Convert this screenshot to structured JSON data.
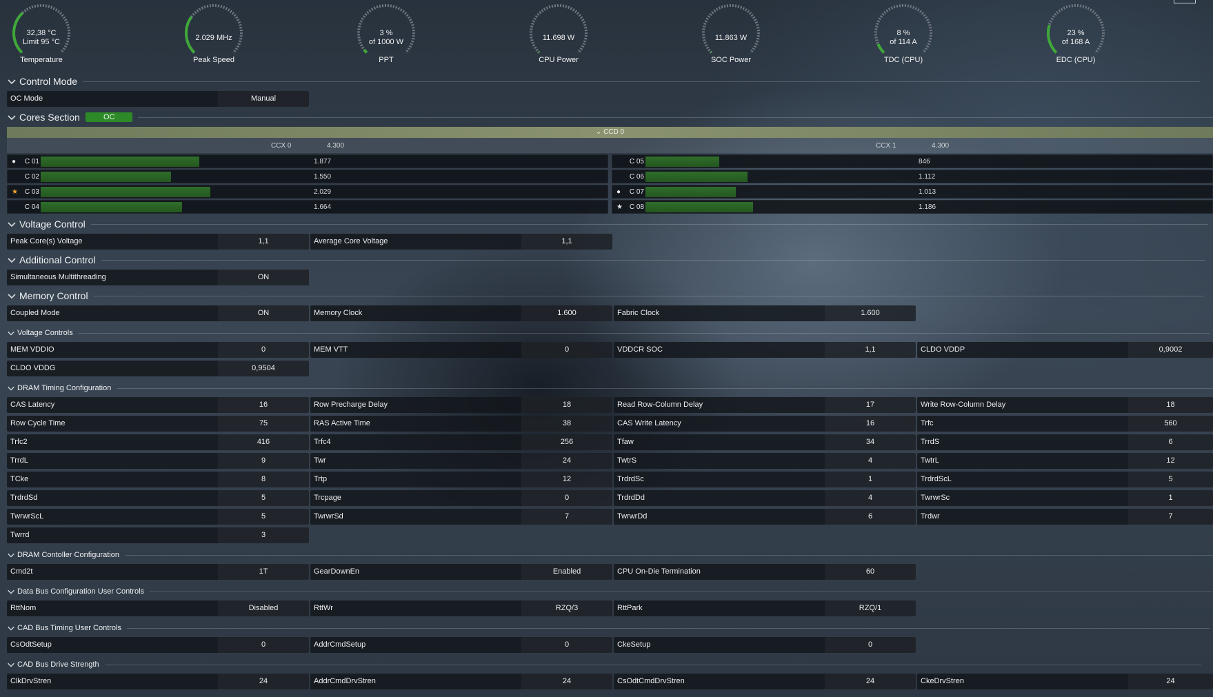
{
  "colors": {
    "accent": "#2e8a28",
    "gauge_track": "#6f7780",
    "gauge_fill": "#3fa838"
  },
  "gauges": [
    {
      "line1": "32,38 °C",
      "line2": "Limit 95 °C",
      "title": "Temperature",
      "level": 0.34
    },
    {
      "line1": "2.029  MHz",
      "line2": "",
      "title": "Peak Speed",
      "level": 0.3
    },
    {
      "line1": "3 %",
      "line2": "of 1000 W",
      "title": "PPT",
      "level": 0.03
    },
    {
      "line1": "11.698 W",
      "line2": "",
      "title": "CPU Power",
      "level": 0.0
    },
    {
      "line1": "11.863 W",
      "line2": "",
      "title": "SOC Power",
      "level": 0.0
    },
    {
      "line1": "8 %",
      "line2": "of 114 A",
      "title": "TDC (CPU)",
      "level": 0.08
    },
    {
      "line1": "23 %",
      "line2": "of 168 A",
      "title": "EDC (CPU)",
      "level": 0.23
    }
  ],
  "sections": {
    "control_mode": "Control Mode",
    "cores_section": "Cores Section",
    "cores_badge": "OC",
    "voltage_control": "Voltage Control",
    "additional_control": "Additional Control",
    "memory_control": "Memory Control",
    "voltage_controls": "Voltage Controls",
    "dram_timing": "DRAM Timing Configuration",
    "dram_controller": "DRAM Contoller Configuration",
    "data_bus": "Data Bus Configuration User Controls",
    "cad_timing": "CAD Bus Timing User Controls",
    "cad_drive": "CAD Bus Drive Strength"
  },
  "control_mode": [
    {
      "k": "OC Mode",
      "v": "Manual"
    }
  ],
  "ccd": {
    "label": "CCD 0",
    "ccx0": {
      "label": "CCX 0",
      "freq": "4.300"
    },
    "ccx1": {
      "label": "CCX 1",
      "freq": "4.300"
    },
    "cores_left": [
      {
        "name": "C 01",
        "value": "1.877",
        "mark": "dot",
        "fill": 0.28
      },
      {
        "name": "C 02",
        "value": "1.550",
        "mark": "",
        "fill": 0.23
      },
      {
        "name": "C 03",
        "value": "2.029",
        "mark": "star",
        "fill": 0.3
      },
      {
        "name": "C 04",
        "value": "1.664",
        "mark": "",
        "fill": 0.25
      }
    ],
    "cores_right": [
      {
        "name": "C 05",
        "value": "846",
        "mark": "",
        "fill": 0.13
      },
      {
        "name": "C 06",
        "value": "1.112",
        "mark": "",
        "fill": 0.18
      },
      {
        "name": "C 07",
        "value": "1.013",
        "mark": "dot",
        "fill": 0.16
      },
      {
        "name": "C 08",
        "value": "1.186",
        "mark": "star-white",
        "fill": 0.19
      }
    ]
  },
  "voltage_control": [
    {
      "k": "Peak Core(s) Voltage",
      "v": "1,1"
    },
    {
      "k": "Average Core Voltage",
      "v": "1,1"
    }
  ],
  "additional_control": [
    {
      "k": "Simultaneous Multithreading",
      "v": "ON"
    }
  ],
  "memory_control": [
    {
      "k": "Coupled Mode",
      "v": "ON"
    },
    {
      "k": "Memory Clock",
      "v": "1.600"
    },
    {
      "k": "Fabric Clock",
      "v": "1.600"
    }
  ],
  "voltage_controls": [
    {
      "k": "MEM VDDIO",
      "v": "0"
    },
    {
      "k": "MEM VTT",
      "v": "0"
    },
    {
      "k": "VDDCR SOC",
      "v": "1,1"
    },
    {
      "k": "CLDO VDDP",
      "v": "0,9002"
    },
    {
      "k": "CLDO VDDG",
      "v": "0,9504"
    }
  ],
  "dram_timing": [
    {
      "k": "CAS Latency",
      "v": "16"
    },
    {
      "k": "Row Precharge Delay",
      "v": "18"
    },
    {
      "k": "Read Row-Column Delay",
      "v": "17"
    },
    {
      "k": "Write Row-Column Delay",
      "v": "18"
    },
    {
      "k": "Row Cycle Time",
      "v": "75"
    },
    {
      "k": "RAS Active Time",
      "v": "38"
    },
    {
      "k": "CAS Write Latency",
      "v": "16"
    },
    {
      "k": "Trfc",
      "v": "560"
    },
    {
      "k": "Trfc2",
      "v": "416"
    },
    {
      "k": "Trfc4",
      "v": "256"
    },
    {
      "k": "Tfaw",
      "v": "34"
    },
    {
      "k": "TrrdS",
      "v": "6"
    },
    {
      "k": "TrrdL",
      "v": "9"
    },
    {
      "k": "Twr",
      "v": "24"
    },
    {
      "k": "TwtrS",
      "v": "4"
    },
    {
      "k": "TwtrL",
      "v": "12"
    },
    {
      "k": "TCke",
      "v": "8"
    },
    {
      "k": "Trtp",
      "v": "12"
    },
    {
      "k": "TrdrdSc",
      "v": "1"
    },
    {
      "k": "TrdrdScL",
      "v": "5"
    },
    {
      "k": "TrdrdSd",
      "v": "5"
    },
    {
      "k": "Trcpage",
      "v": "0"
    },
    {
      "k": "TrdrdDd",
      "v": "4"
    },
    {
      "k": "TwrwrSc",
      "v": "1"
    },
    {
      "k": "TwrwrScL",
      "v": "5"
    },
    {
      "k": "TwrwrSd",
      "v": "7"
    },
    {
      "k": "TwrwrDd",
      "v": "6"
    },
    {
      "k": "Trdwr",
      "v": "7"
    },
    {
      "k": "Twrrd",
      "v": "3"
    }
  ],
  "dram_controller": [
    {
      "k": "Cmd2t",
      "v": "1T"
    },
    {
      "k": "GearDownEn",
      "v": "Enabled"
    },
    {
      "k": "CPU On-Die Termination",
      "v": "60"
    }
  ],
  "data_bus": [
    {
      "k": "RttNom",
      "v": "Disabled"
    },
    {
      "k": "RttWr",
      "v": "RZQ/3"
    },
    {
      "k": "RttPark",
      "v": "RZQ/1"
    }
  ],
  "cad_timing": [
    {
      "k": "CsOdtSetup",
      "v": "0"
    },
    {
      "k": "AddrCmdSetup",
      "v": "0"
    },
    {
      "k": "CkeSetup",
      "v": "0"
    }
  ],
  "cad_drive": [
    {
      "k": "ClkDrvStren",
      "v": "24"
    },
    {
      "k": "AddrCmdDrvStren",
      "v": "24"
    },
    {
      "k": "CsOdtCmdDrvStren",
      "v": "24"
    },
    {
      "k": "CkeDrvStren",
      "v": "24"
    }
  ]
}
